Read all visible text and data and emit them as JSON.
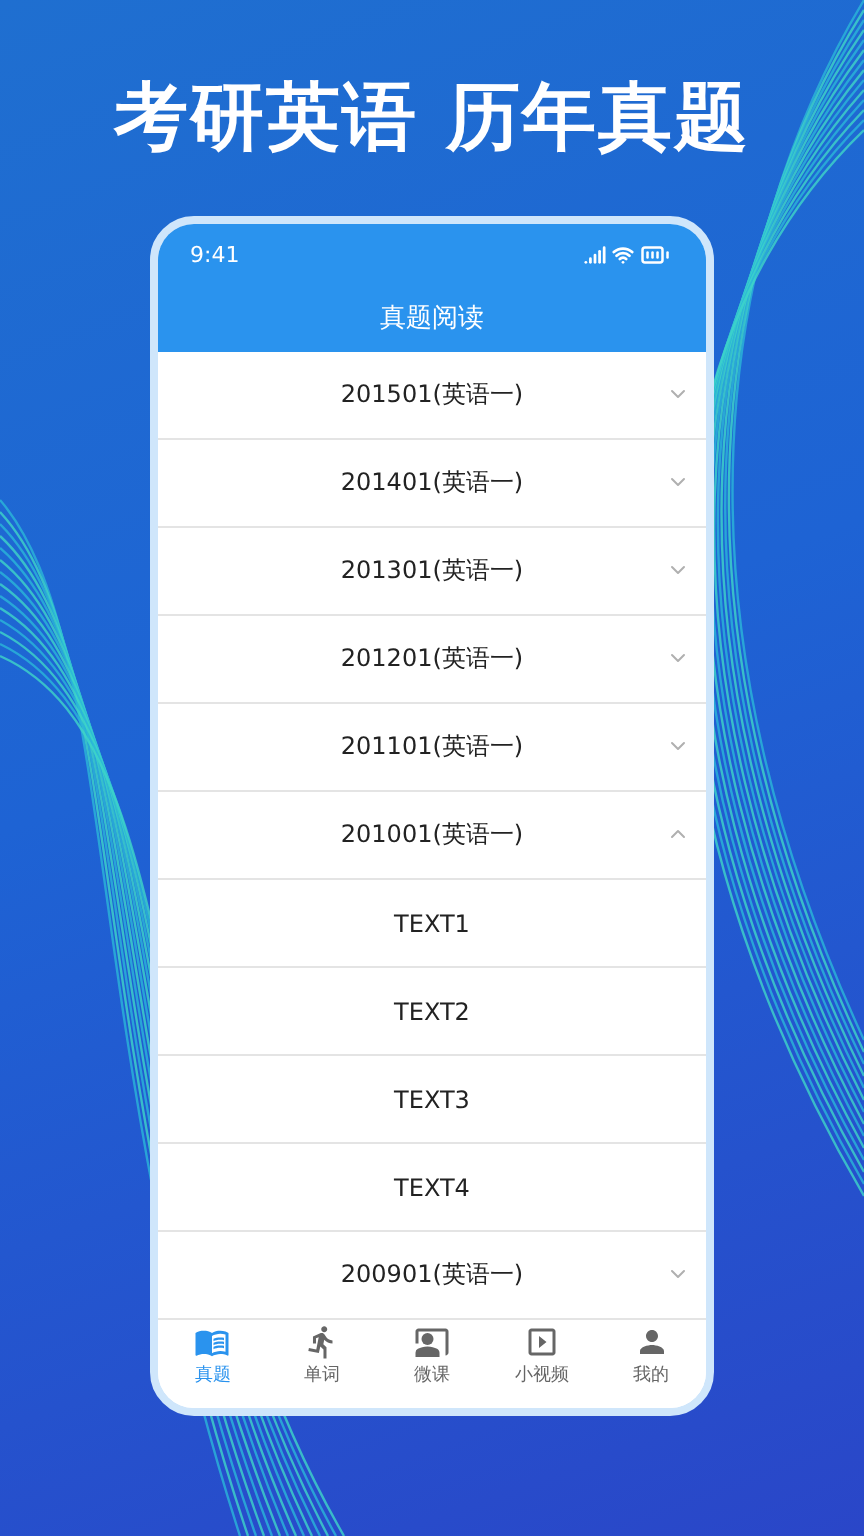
{
  "headline": "考研英语 历年真题",
  "status_bar": {
    "time": "9:41"
  },
  "nav_bar": {
    "title": "真题阅读"
  },
  "years": [
    {
      "label": "201501(英语一)",
      "expanded": false
    },
    {
      "label": "201401(英语一)",
      "expanded": false
    },
    {
      "label": "201301(英语一)",
      "expanded": false
    },
    {
      "label": "201201(英语一)",
      "expanded": false
    },
    {
      "label": "201101(英语一)",
      "expanded": false
    },
    {
      "label": "201001(英语一)",
      "expanded": true,
      "children": [
        {
          "label": "TEXT1"
        },
        {
          "label": "TEXT2"
        },
        {
          "label": "TEXT3"
        },
        {
          "label": "TEXT4"
        }
      ]
    },
    {
      "label": "200901(英语一)",
      "expanded": false
    }
  ],
  "tab_bar": [
    {
      "kind": "book",
      "label": "真题",
      "selected": true
    },
    {
      "kind": "runner",
      "label": "单词",
      "selected": false
    },
    {
      "kind": "board",
      "label": "微课",
      "selected": false
    },
    {
      "kind": "video",
      "label": "小视频",
      "selected": false
    },
    {
      "kind": "person",
      "label": "我的",
      "selected": false
    }
  ]
}
